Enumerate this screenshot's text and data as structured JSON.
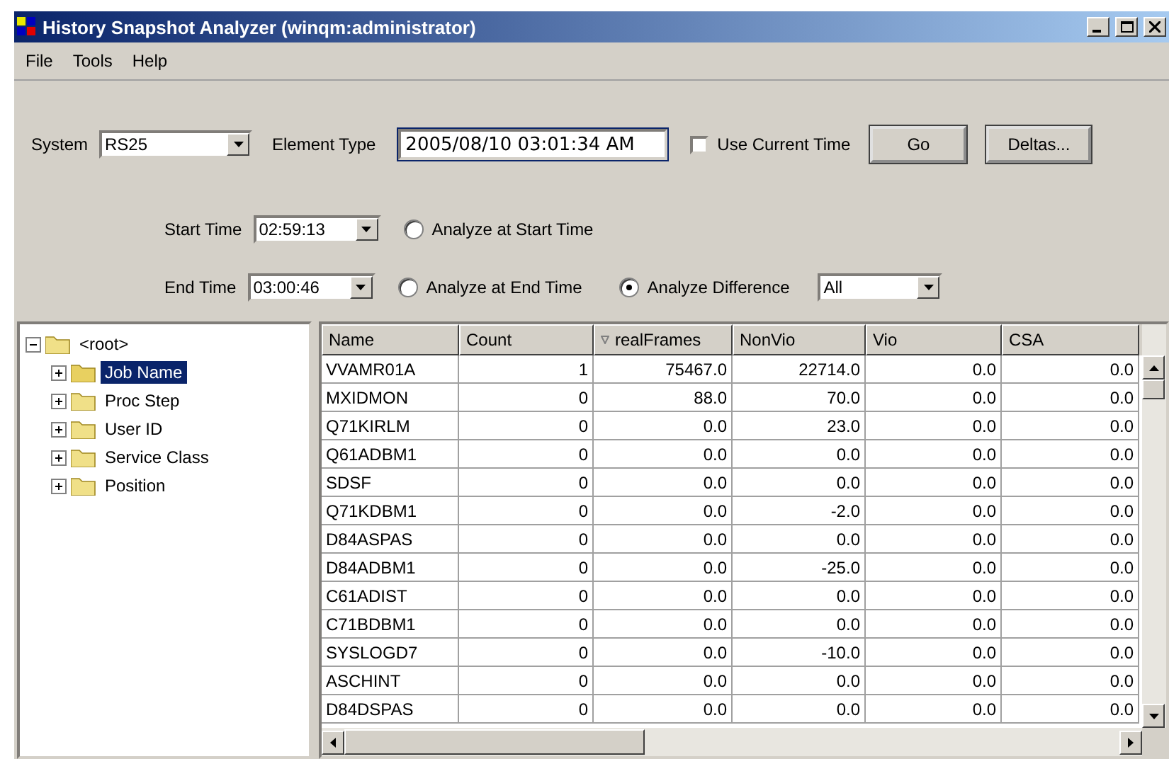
{
  "window": {
    "title": "History Snapshot Analyzer (winqm:administrator)"
  },
  "menu": [
    {
      "label": "File"
    },
    {
      "label": "Tools"
    },
    {
      "label": "Help"
    }
  ],
  "system": {
    "label": "System",
    "value": "RS25"
  },
  "element_type": {
    "label": "Element Type",
    "value": "2005/08/10 03:01:34 AM"
  },
  "use_current_time": {
    "label": "Use Current Time",
    "checked": false
  },
  "buttons": [
    {
      "label": "Go"
    },
    {
      "label": "Deltas..."
    }
  ],
  "time_rows": [
    {
      "label": "Start Time",
      "value": "02:59:13",
      "radios": [
        {
          "label": "Analyze at Start Time",
          "selected": false
        }
      ]
    },
    {
      "label": "End Time",
      "value": "03:00:46",
      "radios": [
        {
          "label": "Analyze at End Time",
          "selected": false
        },
        {
          "label": "Analyze Difference",
          "selected": true
        }
      ],
      "filter": "All"
    }
  ],
  "tree": {
    "label": "<root>",
    "expanded": true,
    "children": [
      {
        "label": "Job Name",
        "selected": true,
        "expanded": false
      },
      {
        "label": "Proc Step",
        "selected": false,
        "expanded": false
      },
      {
        "label": "User ID",
        "selected": false,
        "expanded": false
      },
      {
        "label": "Service Class",
        "selected": false,
        "expanded": false
      },
      {
        "label": "Position",
        "selected": false,
        "expanded": false
      }
    ]
  },
  "table": {
    "columns": [
      {
        "label": "Name",
        "sorted": false
      },
      {
        "label": "Count",
        "sorted": false
      },
      {
        "label": "realFrames",
        "sorted": true
      },
      {
        "label": "NonVio",
        "sorted": false
      },
      {
        "label": "Vio",
        "sorted": false
      },
      {
        "label": "CSA",
        "sorted": false
      }
    ],
    "rows": [
      [
        "VVAMR01A",
        "1",
        "75467.0",
        "22714.0",
        "0.0",
        "0.0"
      ],
      [
        "MXIDMON",
        "0",
        "88.0",
        "70.0",
        "0.0",
        "0.0"
      ],
      [
        "Q71KIRLM",
        "0",
        "0.0",
        "23.0",
        "0.0",
        "0.0"
      ],
      [
        "Q61ADBM1",
        "0",
        "0.0",
        "0.0",
        "0.0",
        "0.0"
      ],
      [
        "SDSF",
        "0",
        "0.0",
        "0.0",
        "0.0",
        "0.0"
      ],
      [
        "Q71KDBM1",
        "0",
        "0.0",
        "-2.0",
        "0.0",
        "0.0"
      ],
      [
        "D84ASPAS",
        "0",
        "0.0",
        "0.0",
        "0.0",
        "0.0"
      ],
      [
        "D84ADBM1",
        "0",
        "0.0",
        "-25.0",
        "0.0",
        "0.0"
      ],
      [
        "C61ADIST",
        "0",
        "0.0",
        "0.0",
        "0.0",
        "0.0"
      ],
      [
        "C71BDBM1",
        "0",
        "0.0",
        "0.0",
        "0.0",
        "0.0"
      ],
      [
        "SYSLOGD7",
        "0",
        "0.0",
        "-10.0",
        "0.0",
        "0.0"
      ],
      [
        "ASCHINT",
        "0",
        "0.0",
        "0.0",
        "0.0",
        "0.0"
      ],
      [
        "D84DSPAS",
        "0",
        "0.0",
        "0.0",
        "0.0",
        "0.0"
      ]
    ]
  }
}
